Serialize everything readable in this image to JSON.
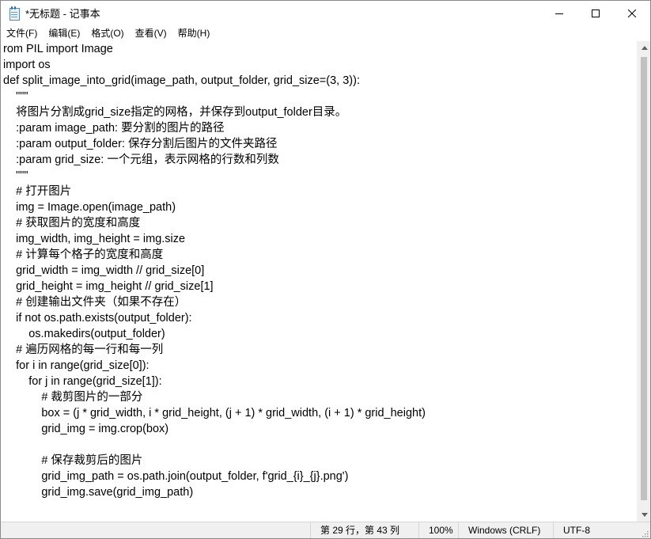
{
  "window": {
    "title": "*无标题 - 记事本",
    "icon": "notepad-icon"
  },
  "menu": {
    "items": [
      {
        "label": "文件(F)"
      },
      {
        "label": "编辑(E)"
      },
      {
        "label": "格式(O)"
      },
      {
        "label": "查看(V)"
      },
      {
        "label": "帮助(H)"
      }
    ]
  },
  "editor": {
    "lines": [
      "rom PIL import Image",
      "import os",
      "def split_image_into_grid(image_path, output_folder, grid_size=(3, 3)):",
      "    \"\"\"",
      "    将图片分割成grid_size指定的网格，并保存到output_folder目录。",
      "    :param image_path: 要分割的图片的路径",
      "    :param output_folder: 保存分割后图片的文件夹路径",
      "    :param grid_size: 一个元组，表示网格的行数和列数",
      "    \"\"\"",
      "    # 打开图片",
      "    img = Image.open(image_path)",
      "    # 获取图片的宽度和高度",
      "    img_width, img_height = img.size",
      "    # 计算每个格子的宽度和高度",
      "    grid_width = img_width // grid_size[0]",
      "    grid_height = img_height // grid_size[1]",
      "    # 创建输出文件夹（如果不存在）",
      "    if not os.path.exists(output_folder):",
      "        os.makedirs(output_folder)",
      "    # 遍历网格的每一行和每一列",
      "    for i in range(grid_size[0]):",
      "        for j in range(grid_size[1]):",
      "            # 裁剪图片的一部分",
      "            box = (j * grid_width, i * grid_height, (j + 1) * grid_width, (i + 1) * grid_height)",
      "            grid_img = img.crop(box)",
      "",
      "            # 保存裁剪后的图片",
      "            grid_img_path = os.path.join(output_folder, f'grid_{i}_{j}.png')",
      "            grid_img.save(grid_img_path)"
    ]
  },
  "status": {
    "position": "第 29 行，第 43 列",
    "zoom": "100%",
    "line_ending": "Windows (CRLF)",
    "encoding": "UTF-8"
  },
  "colors": {
    "statusbar_bg": "#f0f0f0",
    "scrollbar_thumb": "#c1c1c1"
  }
}
